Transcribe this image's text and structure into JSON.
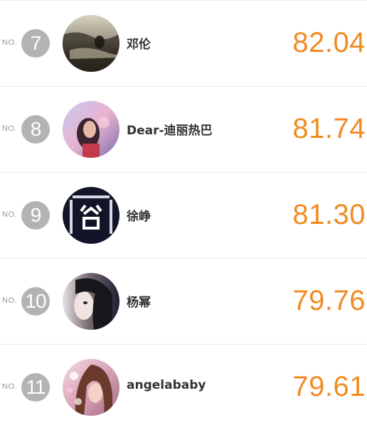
{
  "colors": {
    "score": "#f28a22",
    "rank_badge": "#b3b3b3",
    "name": "#333333",
    "divider": "#e8e8e8"
  },
  "rows": [
    {
      "no_label": "NO.",
      "rank": "7",
      "name": "邓伦",
      "score": "82.04",
      "avatar": "avatar-photo-icon"
    },
    {
      "no_label": "NO.",
      "rank": "8",
      "name": "Dear-迪丽热巴",
      "score": "81.74",
      "avatar": "avatar-photo-icon"
    },
    {
      "no_label": "NO.",
      "rank": "9",
      "name": "徐峥",
      "score": "81.30",
      "avatar": "avatar-photo-icon"
    },
    {
      "no_label": "NO.",
      "rank": "10",
      "name": "杨幂",
      "score": "79.76",
      "avatar": "avatar-photo-icon"
    },
    {
      "no_label": "NO.",
      "rank": "11",
      "name": "angelababy",
      "score": "79.61",
      "avatar": "avatar-photo-icon"
    }
  ]
}
